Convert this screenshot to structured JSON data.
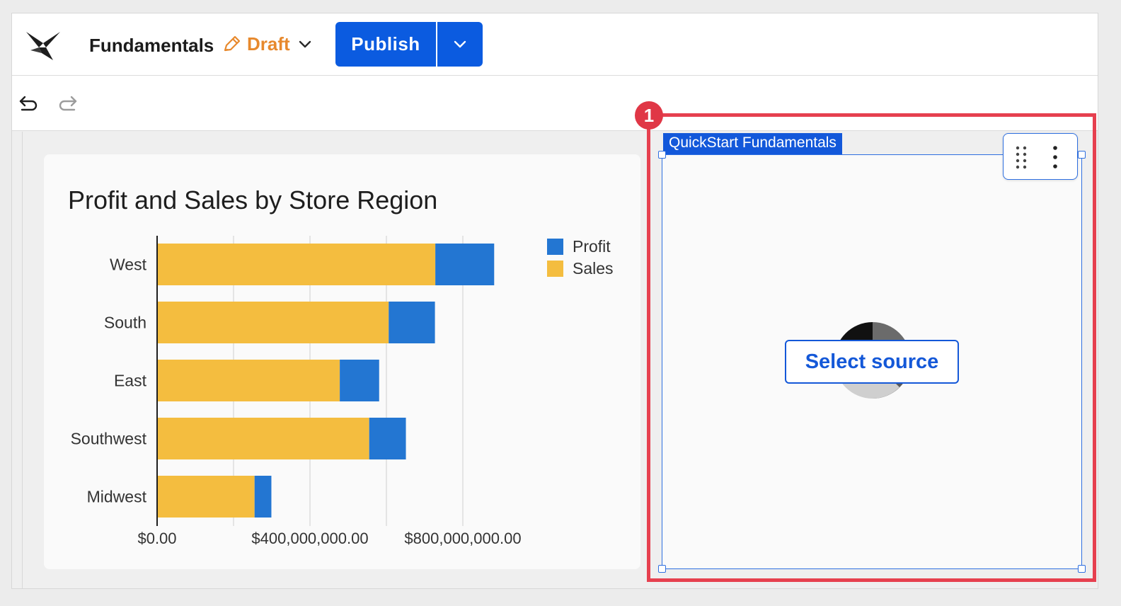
{
  "header": {
    "title": "Fundamentals",
    "status": "Draft",
    "publish_label": "Publish",
    "logo": "sigma-logo-icon"
  },
  "toolbar": {
    "undo_icon": "undo-icon",
    "redo_icon": "redo-icon"
  },
  "chart_card": {
    "title": "Profit and Sales by Store Region"
  },
  "empty_element": {
    "tag_label": "QuickStart Fundamentals",
    "select_source_label": "Select source"
  },
  "callout": {
    "number": "1",
    "color": "#e6404f"
  },
  "colors": {
    "accent": "#0b5be0",
    "draft": "#e7892d",
    "sales": "#f4bd3f",
    "profit": "#2376d2"
  },
  "chart_data": {
    "type": "bar",
    "orientation": "horizontal",
    "stacked": true,
    "title": "Profit and Sales by Store Region",
    "categories": [
      "West",
      "South",
      "East",
      "Southwest",
      "Midwest"
    ],
    "series": [
      {
        "name": "Sales",
        "color": "#f4bd3f",
        "values": [
          728000000,
          606000000,
          478000000,
          555000000,
          255000000
        ]
      },
      {
        "name": "Profit",
        "color": "#2376d2",
        "values": [
          154000000,
          121000000,
          103000000,
          96000000,
          44000000
        ]
      }
    ],
    "x_ticks": [
      "$0.00",
      "$400,000,000.00",
      "$800,000,000.00"
    ],
    "x_gridlines": [
      200000000,
      400000000,
      600000000,
      800000000
    ],
    "xlim": [
      0,
      900000000
    ],
    "legend": {
      "position": "top-right",
      "items": [
        "Profit",
        "Sales"
      ]
    },
    "grid": true
  }
}
